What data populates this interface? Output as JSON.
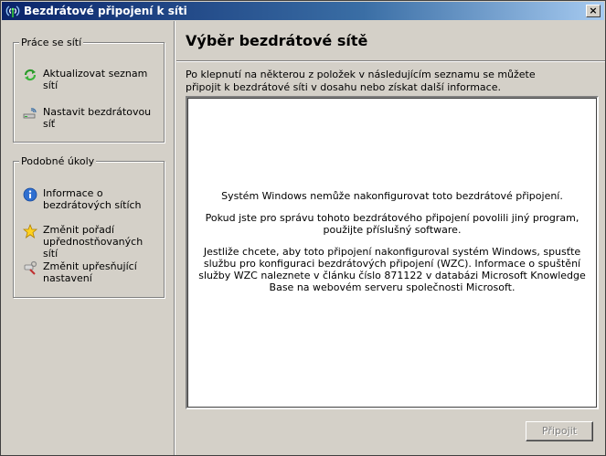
{
  "window": {
    "title": "Bezdrátové připojení k síti",
    "close_glyph": "×"
  },
  "network_tasks": {
    "legend": "Práce se sítí",
    "items": [
      {
        "label": "Aktualizovat seznam sítí",
        "icon": "refresh-icon"
      },
      {
        "label": "Nastavit bezdrátovou síť",
        "icon": "wireless-setup-icon"
      }
    ]
  },
  "related_tasks": {
    "legend": "Podobné úkoly",
    "items": [
      {
        "label": "Informace o bezdrátových sítích",
        "icon": "info-icon"
      },
      {
        "label": "Změnit pořadí upřednostňovaných sítí",
        "icon": "star-icon"
      },
      {
        "label": "Změnit upřesňující nastavení",
        "icon": "settings-icon"
      }
    ]
  },
  "main": {
    "heading": "Výběr bezdrátové sítě",
    "description": "Po klepnutí na některou z položek v následujícím seznamu se můžete připojit k bezdrátové síti v dosahu nebo získat další informace.",
    "messages": [
      "Systém Windows nemůže nakonfigurovat toto bezdrátové připojení.",
      "Pokud jste pro správu tohoto bezdrátového připojení povolili jiný program, použijte příslušný software.",
      "Jestliže chcete, aby toto připojení nakonfiguroval systém Windows, spusťte službu pro konfiguraci bezdrátových připojení (WZC). Informace o spuštění služby WZC naleznete v článku číslo 871122 v databázi Microsoft Knowledge Base na webovém serveru společnosti Microsoft."
    ],
    "connect_label": "Připojit"
  },
  "colors": {
    "titlebar_start": "#0a246a",
    "titlebar_end": "#a6caf0",
    "face": "#d4d0c8"
  }
}
